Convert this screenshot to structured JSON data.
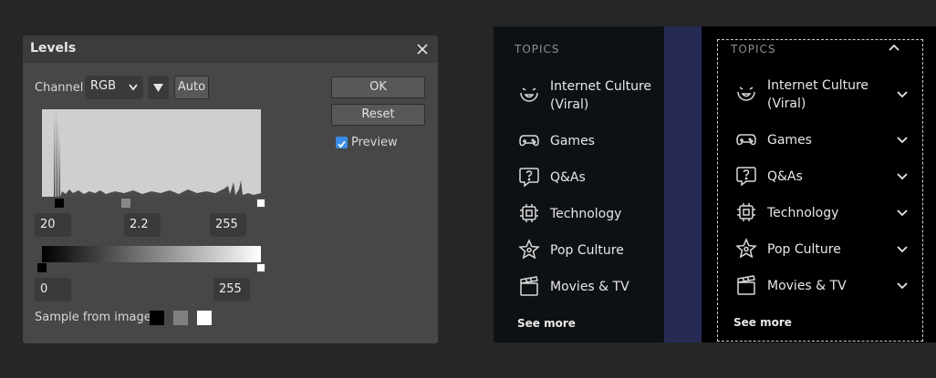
{
  "levels": {
    "title": "Levels",
    "channel_label": "Channel:",
    "channel_value": "RGB",
    "auto_label": "Auto",
    "ok_label": "OK",
    "reset_label": "Reset",
    "preview_label": "Preview",
    "preview_checked": true,
    "input_black": "20",
    "input_gamma": "2.2",
    "input_white": "255",
    "output_black": "0",
    "output_white": "255",
    "sample_label": "Sample from image:",
    "sample_swatches": [
      "#000000",
      "#808080",
      "#ffffff"
    ]
  },
  "topics_left": {
    "heading": "TOPICS",
    "items": [
      {
        "label": "Internet Culture (Viral)",
        "icon": "laughing-face-icon"
      },
      {
        "label": "Games",
        "icon": "gamepad-icon"
      },
      {
        "label": "Q&As",
        "icon": "question-bubble-icon"
      },
      {
        "label": "Technology",
        "icon": "chip-icon"
      },
      {
        "label": "Pop Culture",
        "icon": "star-badge-icon"
      },
      {
        "label": "Movies & TV",
        "icon": "clapperboard-icon"
      }
    ],
    "see_more": "See more"
  },
  "topics_right": {
    "heading": "TOPICS",
    "items": [
      {
        "label": "Internet Culture (Viral)",
        "icon": "laughing-face-icon"
      },
      {
        "label": "Games",
        "icon": "gamepad-icon"
      },
      {
        "label": "Q&As",
        "icon": "question-bubble-icon"
      },
      {
        "label": "Technology",
        "icon": "chip-icon"
      },
      {
        "label": "Pop Culture",
        "icon": "star-badge-icon"
      },
      {
        "label": "Movies & TV",
        "icon": "clapperboard-icon"
      }
    ],
    "see_more": "See more"
  },
  "colors": {
    "dialog_bg": "#474747",
    "panel_bg": "#0e1114",
    "strip_accent": "#262a55",
    "preview_check": "#3b8de5"
  }
}
